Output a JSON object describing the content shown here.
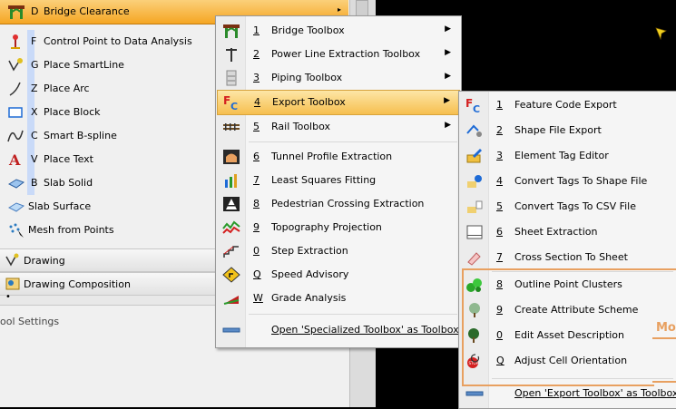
{
  "tool_panel": {
    "rows": [
      {
        "key": "D",
        "label": "Bridge Clearance"
      },
      {
        "key": "F",
        "label": "Control Point to Data Analysis"
      },
      {
        "key": "G",
        "label": "Place SmartLine"
      },
      {
        "key": "Z",
        "label": "Place Arc"
      },
      {
        "key": "X",
        "label": "Place Block"
      },
      {
        "key": "C",
        "label": "Smart B-spline"
      },
      {
        "key": "V",
        "label": "Place Text"
      },
      {
        "key": "B",
        "label": "Slab Solid"
      },
      {
        "key": "",
        "label": "Slab Surface"
      },
      {
        "key": "",
        "label": "Mesh from Points"
      }
    ],
    "sections": [
      {
        "label": "Drawing"
      },
      {
        "label": "Drawing Composition"
      }
    ],
    "dot": "•",
    "tool_settings_label": "Tool Settings",
    "tool_settings_visible": "ool Settings"
  },
  "menu1": {
    "items": [
      {
        "key": "1",
        "label": "Bridge Toolbox",
        "submenu": true
      },
      {
        "key": "2",
        "label": "Power Line Extraction Toolbox",
        "submenu": true
      },
      {
        "key": "3",
        "label": "Piping Toolbox",
        "submenu": true
      },
      {
        "key": "4",
        "label": "Export Toolbox",
        "submenu": true
      },
      {
        "key": "5",
        "label": "Rail Toolbox",
        "submenu": true
      },
      {
        "key": "6",
        "label": "Tunnel Profile Extraction"
      },
      {
        "key": "7",
        "label": "Least Squares Fitting"
      },
      {
        "key": "8",
        "label": "Pedestrian Crossing Extraction"
      },
      {
        "key": "9",
        "label": "Topography Projection"
      },
      {
        "key": "0",
        "label": "Step Extraction"
      },
      {
        "key": "Q",
        "label": "Speed Advisory"
      },
      {
        "key": "W",
        "label": "Grade Analysis"
      }
    ],
    "open_label": "Open 'Specialized Toolbox' as Toolbox",
    "arrow": "▶"
  },
  "menu2": {
    "items": [
      {
        "key": "1",
        "label": "Feature Code Export"
      },
      {
        "key": "2",
        "label": "Shape File Export"
      },
      {
        "key": "3",
        "label": "Element Tag Editor"
      },
      {
        "key": "4",
        "label": "Convert Tags To Shape File"
      },
      {
        "key": "5",
        "label": "Convert Tags To CSV File"
      },
      {
        "key": "6",
        "label": "Sheet Extraction"
      },
      {
        "key": "7",
        "label": "Cross Section To Sheet"
      },
      {
        "key": "8",
        "label": "Outline Point Clusters"
      },
      {
        "key": "9",
        "label": "Create Attribute Scheme"
      },
      {
        "key": "0",
        "label": "Edit Asset Description"
      },
      {
        "key": "Q",
        "label": "Adjust Cell Orientation"
      }
    ],
    "open_label": "Open 'Export Toolbox' as Toolbox"
  },
  "callout": {
    "text": "Mo",
    "color": "#e8a060"
  },
  "colors": {
    "highlight": "#f6bf4f",
    "accent": "#1e6bd6",
    "fc_red": "#d42020"
  }
}
